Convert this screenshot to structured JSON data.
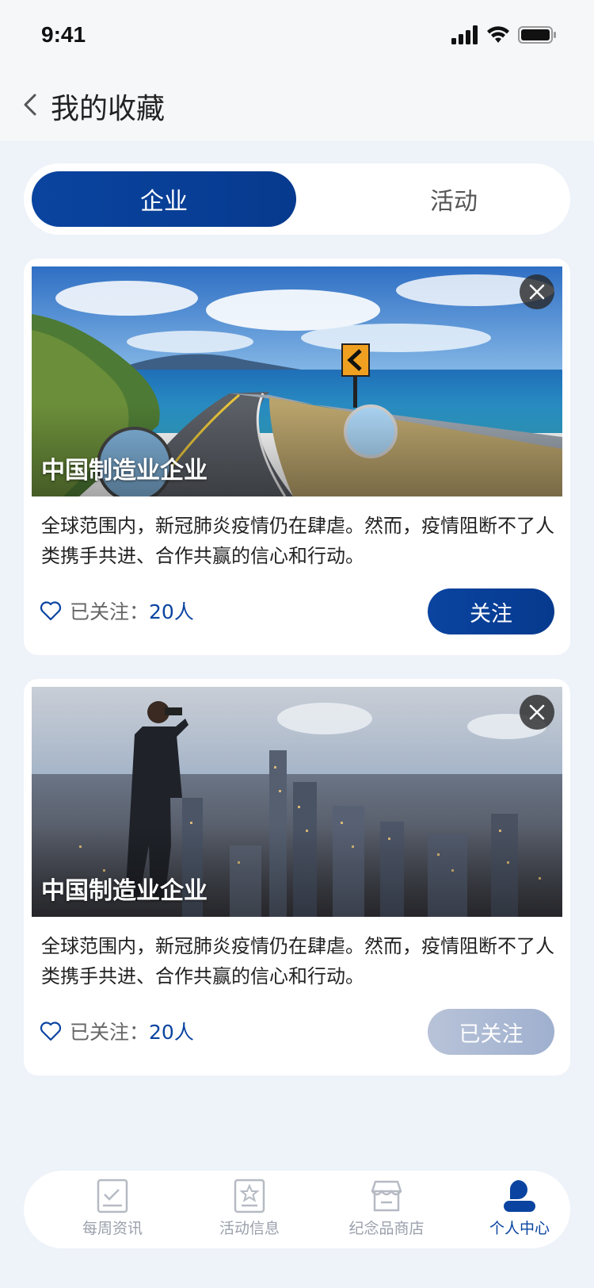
{
  "status": {
    "time": "9:41"
  },
  "header": {
    "title": "我的收藏"
  },
  "segment": {
    "tabs": [
      {
        "label": "企业"
      },
      {
        "label": "活动"
      }
    ]
  },
  "cards": [
    {
      "name": "中国制造业企业",
      "description": "全球范围内，新冠肺炎疫情仍在肆虐。然而，疫情阻断不了人类携手共进、合作共赢的信心和行动。",
      "follow_label": "已关注：",
      "follow_count": "20人",
      "button_label": "关注"
    },
    {
      "name": "中国制造业企业",
      "description": "全球范围内，新冠肺炎疫情仍在肆虐。然而，疫情阻断不了人类携手共进、合作共赢的信心和行动。",
      "follow_label": "已关注：",
      "follow_count": "20人",
      "button_label": "已关注"
    }
  ],
  "tabbar": {
    "items": [
      {
        "label": "每周资讯",
        "icon": "news-icon"
      },
      {
        "label": "活动信息",
        "icon": "star-doc-icon"
      },
      {
        "label": "纪念品商店",
        "icon": "store-icon"
      },
      {
        "label": "个人中心",
        "icon": "user-icon"
      }
    ]
  },
  "colors": {
    "primary": "#0a44a0",
    "background": "#eef2f9",
    "inactive_text": "#9aa0ab"
  }
}
